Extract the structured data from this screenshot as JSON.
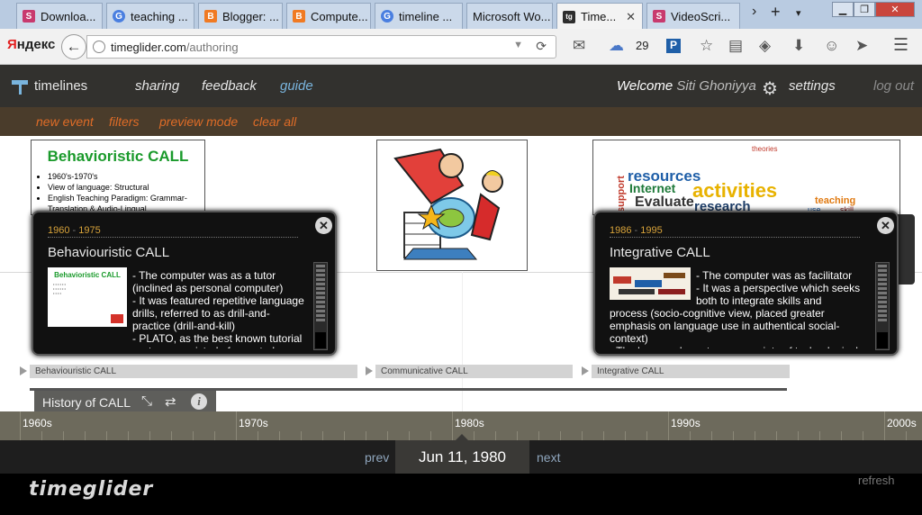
{
  "browser": {
    "tabs": [
      {
        "label": "Downloa...",
        "fav_color": "#c83a6e",
        "fav_char": "S"
      },
      {
        "label": "teaching ...",
        "fav_color": "#4a7fe0",
        "fav_char": "G"
      },
      {
        "label": "Blogger: ...",
        "fav_color": "#f07a23",
        "fav_char": "B"
      },
      {
        "label": "Compute...",
        "fav_color": "#f07a23",
        "fav_char": "B"
      },
      {
        "label": "timeline ...",
        "fav_color": "#4a7fe0",
        "fav_char": "G"
      },
      {
        "label": "Microsoft Wo...",
        "fav_color": "",
        "fav_char": ""
      },
      {
        "label": "Time...",
        "fav_color": "#2d2d2d",
        "fav_char": "tg"
      },
      {
        "label": "VideoScri...",
        "fav_color": "#c83a6e",
        "fav_char": "S"
      }
    ],
    "yandex_first": "Я",
    "yandex_rest": "ндекс",
    "url_host": "timeglider.com",
    "url_path": "/authoring",
    "weather_temp": "29"
  },
  "menu": {
    "timelines": "timelines",
    "sharing": "sharing",
    "feedback": "feedback",
    "guide": "guide",
    "welcome": "Welcome",
    "user": "Siti Ghoniyya",
    "settings": "settings",
    "logout": "log out"
  },
  "submenu": {
    "new_event": "new event",
    "filters": "filters",
    "preview_mode": "preview mode",
    "clear_all": "clear all"
  },
  "thumb1": {
    "title": "Behavioristic CALL",
    "bullets": [
      "1960's-1970's",
      "View of language: Structural",
      "English Teaching Paradigm: Grammar-Translation & Audio-Lingual"
    ]
  },
  "wordcloud": [
    "activities",
    "resources",
    "Internet",
    "Evaluate",
    "research",
    "teaching",
    "theories",
    "support",
    "skill",
    "use"
  ],
  "popup1": {
    "year_start": "1960",
    "year_sep": "-",
    "year_end": "1975",
    "title": "Behaviouristic CALL",
    "img_title": "Behavioristic CALL",
    "text": "- The computer was as a tutor (inclined as personal computer)\n- It was featured repetitive language drills, referred to as drill-and-practice (drill-and-kill)\n- PLATO, as the best known tutorial system, consisted of a central computer and terminals"
  },
  "popup2": {
    "year_start": "1986",
    "year_sep": "-",
    "year_end": "1995",
    "title": "Integrative CALL",
    "text_side": "- The computer was as facilitator\n- It was a perspective which seeks both to integrate skills and technology into the language learning",
    "text_full": "process (socio-cognitive view, placed greater emphasis on language use in authentical social-context)\n- The learners learn to use a variety of technological tool"
  },
  "bands": [
    {
      "label": "Behaviouristic CALL"
    },
    {
      "label": "Communicative CALL"
    },
    {
      "label": "Integrative CALL"
    }
  ],
  "legend_title": "History of CALL",
  "ruler": [
    "1960s",
    "1970s",
    "1980s",
    "1990s",
    "2000s"
  ],
  "footer": {
    "prev": "prev",
    "date": "Jun 11, 1980",
    "next": "next",
    "brand": "timeglider",
    "refresh": "refresh"
  }
}
